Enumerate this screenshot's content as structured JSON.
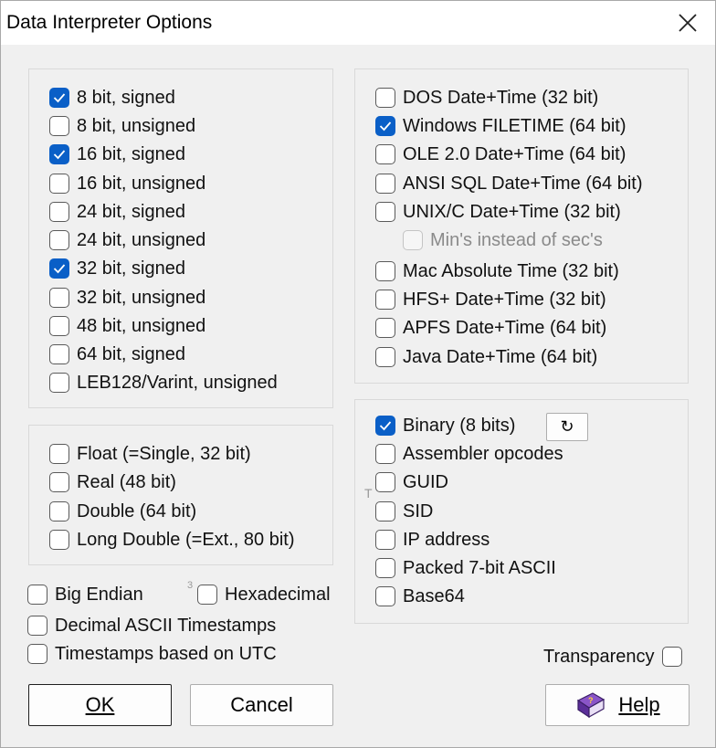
{
  "window": {
    "title": "Data Interpreter Options"
  },
  "integers": [
    {
      "label": "8 bit, signed",
      "checked": true
    },
    {
      "label": "8 bit, unsigned",
      "checked": false
    },
    {
      "label": "16 bit, signed",
      "checked": true
    },
    {
      "label": "16 bit, unsigned",
      "checked": false
    },
    {
      "label": "24 bit, signed",
      "checked": false
    },
    {
      "label": "24 bit, unsigned",
      "checked": false
    },
    {
      "label": "32 bit, signed",
      "checked": true
    },
    {
      "label": "32 bit, unsigned",
      "checked": false
    },
    {
      "label": "48 bit, unsigned",
      "checked": false
    },
    {
      "label": "64 bit, signed",
      "checked": false
    },
    {
      "label": "LEB128/Varint, unsigned",
      "checked": false
    }
  ],
  "floats": [
    {
      "label": "Float (=Single, 32 bit)",
      "checked": false
    },
    {
      "label": "Real (48 bit)",
      "checked": false
    },
    {
      "label": "Double (64 bit)",
      "checked": false
    },
    {
      "label": "Long Double (=Ext., 80 bit)",
      "checked": false
    }
  ],
  "dates": [
    {
      "label": "DOS Date+Time (32 bit)",
      "checked": false
    },
    {
      "label": "Windows FILETIME (64 bit)",
      "checked": true
    },
    {
      "label": "OLE 2.0 Date+Time (64 bit)",
      "checked": false
    },
    {
      "label": "ANSI SQL Date+Time (64 bit)",
      "checked": false
    },
    {
      "label": "UNIX/C Date+Time (32 bit)",
      "checked": false
    },
    {
      "label": "Min's instead of sec's",
      "checked": false,
      "disabled": true
    },
    {
      "label": "Mac Absolute Time (32 bit)",
      "checked": false
    },
    {
      "label": "HFS+ Date+Time (32 bit)",
      "checked": false
    },
    {
      "label": "APFS Date+Time (64 bit)",
      "checked": false
    },
    {
      "label": "Java Date+Time (64 bit)",
      "checked": false
    }
  ],
  "misc": [
    {
      "label": "Binary (8 bits)",
      "checked": true
    },
    {
      "label": "Assembler opcodes",
      "checked": false
    },
    {
      "label": "GUID",
      "checked": false
    },
    {
      "label": "SID",
      "checked": false
    },
    {
      "label": "IP address",
      "checked": false
    },
    {
      "label": "Packed 7-bit ASCII",
      "checked": false
    },
    {
      "label": "Base64",
      "checked": false
    }
  ],
  "options": {
    "big_endian": "Big Endian",
    "hexadecimal": "Hexadecimal",
    "decimal_ascii": "Decimal ASCII Timestamps",
    "utc": "Timestamps based on UTC",
    "transparency": "Transparency"
  },
  "markers": {
    "three": "3",
    "t": "T"
  },
  "buttons": {
    "ok": "OK",
    "cancel": "Cancel",
    "help": "Help",
    "refresh": "↻"
  },
  "colors": {
    "accent": "#0a5fc7",
    "background": "#f0f0f0"
  },
  "icons": {
    "help": "book-icon",
    "refresh": "refresh-icon",
    "close": "close-icon"
  }
}
